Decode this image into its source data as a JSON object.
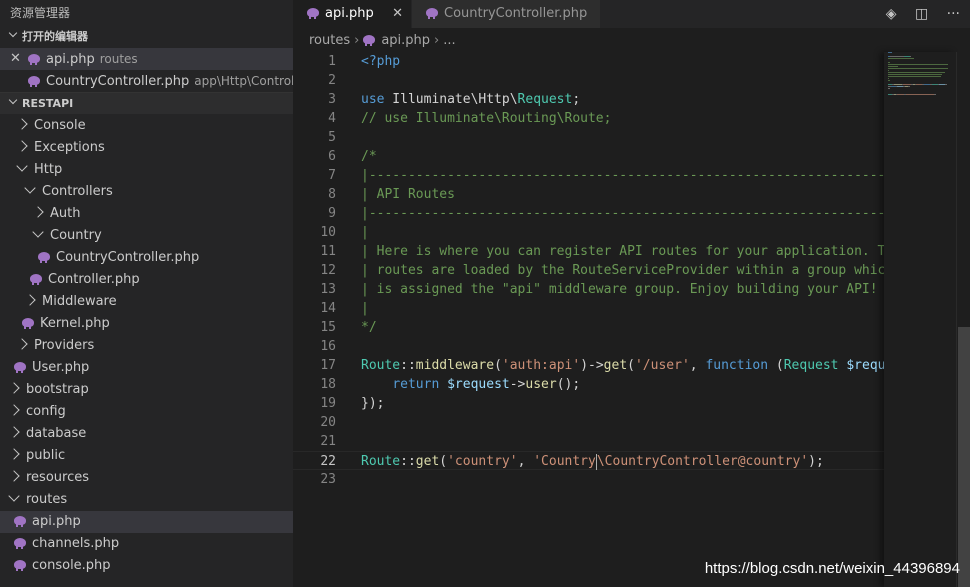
{
  "sidebar": {
    "title": "资源管理器",
    "open_editors_header": "打开的编辑器",
    "open_editors": [
      {
        "name": "api.php",
        "desc": "routes"
      },
      {
        "name": "CountryController.php",
        "desc": "app\\Http\\Controller..."
      }
    ],
    "project_header": "RESTAPI",
    "tree": [
      {
        "label": "Console",
        "type": "folder",
        "expanded": false
      },
      {
        "label": "Exceptions",
        "type": "folder",
        "expanded": false
      },
      {
        "label": "Http",
        "type": "folder",
        "expanded": true
      },
      {
        "label": "Controllers",
        "type": "folder",
        "expanded": true
      },
      {
        "label": "Auth",
        "type": "folder",
        "expanded": false
      },
      {
        "label": "Country",
        "type": "folder",
        "expanded": true
      },
      {
        "label": "CountryController.php",
        "type": "file"
      },
      {
        "label": "Controller.php",
        "type": "file"
      },
      {
        "label": "Middleware",
        "type": "folder",
        "expanded": false
      },
      {
        "label": "Kernel.php",
        "type": "file"
      },
      {
        "label": "Providers",
        "type": "folder",
        "expanded": false
      },
      {
        "label": "User.php",
        "type": "file"
      },
      {
        "label": "bootstrap",
        "type": "folder",
        "expanded": false
      },
      {
        "label": "config",
        "type": "folder",
        "expanded": false
      },
      {
        "label": "database",
        "type": "folder",
        "expanded": false
      },
      {
        "label": "public",
        "type": "folder",
        "expanded": false
      },
      {
        "label": "resources",
        "type": "folder",
        "expanded": false
      },
      {
        "label": "routes",
        "type": "folder",
        "expanded": true
      },
      {
        "label": "api.php",
        "type": "file"
      },
      {
        "label": "channels.php",
        "type": "file"
      },
      {
        "label": "console.php",
        "type": "file"
      }
    ]
  },
  "tabs": [
    {
      "label": "api.php",
      "active": true
    },
    {
      "label": "CountryController.php",
      "active": false
    }
  ],
  "tab_actions": [
    "source-control-icon",
    "split-editor-icon",
    "more-icon"
  ],
  "breadcrumb": [
    "routes",
    "api.php",
    "..."
  ],
  "editor": {
    "current_line": 22,
    "lines": [
      {
        "n": "1",
        "tokens": [
          {
            "t": "<?php",
            "c": "kw"
          }
        ]
      },
      {
        "n": "2",
        "tokens": []
      },
      {
        "n": "3",
        "tokens": [
          {
            "t": "use",
            "c": "kw"
          },
          {
            "t": " Illuminate\\Http\\",
            "c": "pl"
          },
          {
            "t": "Request",
            "c": "cl"
          },
          {
            "t": ";",
            "c": "pl"
          }
        ]
      },
      {
        "n": "4",
        "tokens": [
          {
            "t": "// use Illuminate\\Routing\\Route;",
            "c": "cm"
          }
        ]
      },
      {
        "n": "5",
        "tokens": []
      },
      {
        "n": "6",
        "tokens": [
          {
            "t": "/*",
            "c": "cm"
          }
        ]
      },
      {
        "n": "7",
        "tokens": [
          {
            "t": "|--------------------------------------------------------------------------",
            "c": "cm"
          }
        ]
      },
      {
        "n": "8",
        "tokens": [
          {
            "t": "| API Routes",
            "c": "cm"
          }
        ]
      },
      {
        "n": "9",
        "tokens": [
          {
            "t": "|--------------------------------------------------------------------------",
            "c": "cm"
          }
        ]
      },
      {
        "n": "10",
        "tokens": [
          {
            "t": "|",
            "c": "cm"
          }
        ]
      },
      {
        "n": "11",
        "tokens": [
          {
            "t": "| Here is where you can register API routes for your application. These",
            "c": "cm"
          }
        ]
      },
      {
        "n": "12",
        "tokens": [
          {
            "t": "| routes are loaded by the RouteServiceProvider within a group which",
            "c": "cm"
          }
        ]
      },
      {
        "n": "13",
        "tokens": [
          {
            "t": "| is assigned the \"api\" middleware group. Enjoy building your API!",
            "c": "cm"
          }
        ]
      },
      {
        "n": "14",
        "tokens": [
          {
            "t": "|",
            "c": "cm"
          }
        ]
      },
      {
        "n": "15",
        "tokens": [
          {
            "t": "*/",
            "c": "cm"
          }
        ]
      },
      {
        "n": "16",
        "tokens": []
      },
      {
        "n": "17",
        "tokens": [
          {
            "t": "Route",
            "c": "cl"
          },
          {
            "t": "::",
            "c": "pl"
          },
          {
            "t": "middleware",
            "c": "fn"
          },
          {
            "t": "(",
            "c": "pl"
          },
          {
            "t": "'auth:api'",
            "c": "st"
          },
          {
            "t": ")->",
            "c": "pl"
          },
          {
            "t": "get",
            "c": "fn"
          },
          {
            "t": "(",
            "c": "pl"
          },
          {
            "t": "'/user'",
            "c": "st"
          },
          {
            "t": ", ",
            "c": "pl"
          },
          {
            "t": "function",
            "c": "kw"
          },
          {
            "t": " (",
            "c": "pl"
          },
          {
            "t": "Request",
            "c": "cl"
          },
          {
            "t": " ",
            "c": "pl"
          },
          {
            "t": "$request",
            "c": "vr"
          },
          {
            "t": ") {",
            "c": "pl"
          }
        ]
      },
      {
        "n": "18",
        "tokens": [
          {
            "t": "    ",
            "c": "pl"
          },
          {
            "t": "return",
            "c": "kw"
          },
          {
            "t": " ",
            "c": "pl"
          },
          {
            "t": "$request",
            "c": "vr"
          },
          {
            "t": "->",
            "c": "pl"
          },
          {
            "t": "user",
            "c": "fn"
          },
          {
            "t": "();",
            "c": "pl"
          }
        ]
      },
      {
        "n": "19",
        "tokens": [
          {
            "t": "});",
            "c": "pl"
          }
        ]
      },
      {
        "n": "20",
        "tokens": []
      },
      {
        "n": "21",
        "tokens": []
      },
      {
        "n": "22",
        "tokens": [
          {
            "t": "Route",
            "c": "cl"
          },
          {
            "t": "::",
            "c": "pl"
          },
          {
            "t": "get",
            "c": "fn"
          },
          {
            "t": "(",
            "c": "pl"
          },
          {
            "t": "'country'",
            "c": "st"
          },
          {
            "t": ", ",
            "c": "pl"
          },
          {
            "t": "'Country",
            "c": "st"
          },
          {
            "t": "|cursor|",
            "c": "cursor"
          },
          {
            "t": "\\CountryController@country'",
            "c": "st"
          },
          {
            "t": ");",
            "c": "pl"
          }
        ]
      },
      {
        "n": "23",
        "tokens": []
      }
    ]
  },
  "colors": {
    "sidebar_bg": "#252526",
    "editor_bg": "#1e1e1e",
    "keyword": "#569cd6",
    "comment": "#6a9955",
    "string": "#ce9178",
    "class": "#4ec9b0",
    "function": "#dcdcaa",
    "variable": "#9cdcfe",
    "php_icon": "#a074c4"
  },
  "watermark": "https://blog.csdn.net/weixin_44396894"
}
